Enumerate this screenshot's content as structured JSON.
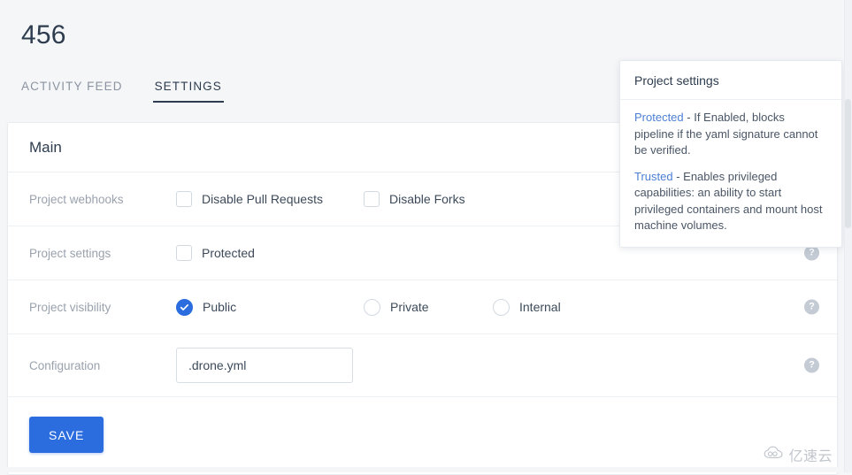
{
  "page": {
    "project_title": "456",
    "background_color": "#f5f6f8",
    "accent_color": "#2b6cdf"
  },
  "tabs": [
    {
      "label": "ACTIVITY FEED",
      "active": false
    },
    {
      "label": "SETTINGS",
      "active": true
    }
  ],
  "card": {
    "header_title": "Main",
    "rows": [
      {
        "label": "Project webhooks",
        "type": "checkbox",
        "help_icon": "question-mark-icon",
        "options": [
          {
            "label": "Disable Pull Requests",
            "checked": false
          },
          {
            "label": "Disable Forks",
            "checked": false
          }
        ]
      },
      {
        "label": "Project settings",
        "type": "checkbox",
        "help_icon": "question-mark-icon",
        "options": [
          {
            "label": "Protected",
            "checked": false
          }
        ]
      },
      {
        "label": "Project visibility",
        "type": "radio",
        "help_icon": "question-mark-icon",
        "options": [
          {
            "label": "Public",
            "checked": true
          },
          {
            "label": "Private",
            "checked": false
          },
          {
            "label": "Internal",
            "checked": false
          }
        ]
      },
      {
        "label": "Configuration",
        "type": "text",
        "help_icon": "question-mark-icon",
        "value": ".drone.yml",
        "placeholder": ".drone.yml"
      }
    ],
    "save_label": "SAVE"
  },
  "tooltip": {
    "title": "Project settings",
    "paragraphs": [
      {
        "term": "Protected",
        "text": " - If Enabled, blocks pipeline if the yaml signature cannot be verified."
      },
      {
        "term": "Trusted",
        "text": " - Enables privileged capabilities: an ability to start privileged containers and mount host machine volumes."
      }
    ]
  },
  "watermark": {
    "text": "亿速云",
    "icon": "cloud-icon"
  }
}
